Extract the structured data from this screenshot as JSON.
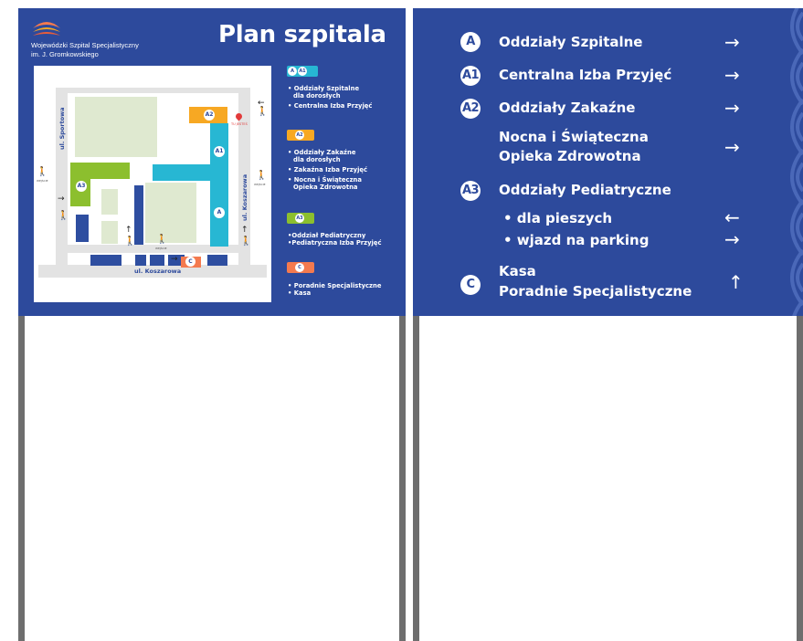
{
  "left_sign": {
    "hospital_name_line1": "Wojewódzki Szpital Specjalistyczny",
    "hospital_name_line2": "im. J. Gromkowskiego",
    "title": "Plan szpitala",
    "map": {
      "street_sportowa": "ul. Sportowa",
      "street_koszarowa_vertical": "ul. Koszarowa",
      "street_koszarowa_bottom": "ul. Koszarowa",
      "pin_label": "TU JESTEŚ",
      "entrance_label": "WEJŚCIE",
      "building_labels": {
        "a": "A",
        "a1": "A1",
        "a2": "A2",
        "a3": "A3",
        "c": "C"
      }
    },
    "legend": {
      "group1": {
        "badges": [
          "A",
          "A1"
        ],
        "color": "#27b7d3",
        "items": [
          "• Oddziały Szpitalne",
          "  dla dorosłych",
          "• Centralna Izba Przyjęć"
        ]
      },
      "group2": {
        "badge": "A2",
        "color": "#f7a823",
        "items": [
          "• Oddziały Zakaźne",
          "  dla dorosłych",
          "• Zakaźna Izba Przyjęć",
          "• Nocna i Świąteczna",
          "  Opieka Zdrowotna"
        ]
      },
      "group3": {
        "badge": "A3",
        "color": "#8cbf2e",
        "items": [
          "•Oddział Pediatryczny",
          "•Pediatryczna Izba Przyjęć"
        ]
      },
      "group4": {
        "badge": "C",
        "color": "#f47a4f",
        "items": [
          "• Poradnie Specjalistyczne",
          "• Kasa"
        ]
      }
    }
  },
  "right_sign": {
    "rows": [
      {
        "badge": "A",
        "text": "Oddziały Szpitalne",
        "arrow": "→"
      },
      {
        "badge": "A1",
        "text": "Centralna Izba Przyjęć",
        "arrow": "→"
      },
      {
        "badge": "A2",
        "text": "Oddziały Zakaźne",
        "arrow": "→"
      }
    ],
    "nocna_line1": "Nocna i Świąteczna",
    "nocna_line2": "Opieka Zdrowotna",
    "nocna_arrow": "→",
    "a3": {
      "badge": "A3",
      "text": "Oddziały Pediatryczne"
    },
    "pieszych": {
      "text": "• dla pieszych",
      "arrow": "←"
    },
    "parking": {
      "text": "• wjazd na parking",
      "arrow": "→"
    },
    "c": {
      "badge": "C",
      "line1": "Kasa",
      "line2": "Poradnie Specjalistyczne",
      "arrow": "↑"
    }
  },
  "colors": {
    "panel_blue": "#2d4a9c",
    "post_gray": "#6e6e6e",
    "cyan": "#27b7d3",
    "orange": "#f7a823",
    "green": "#8cbf2e",
    "salmon": "#f47a4f"
  }
}
